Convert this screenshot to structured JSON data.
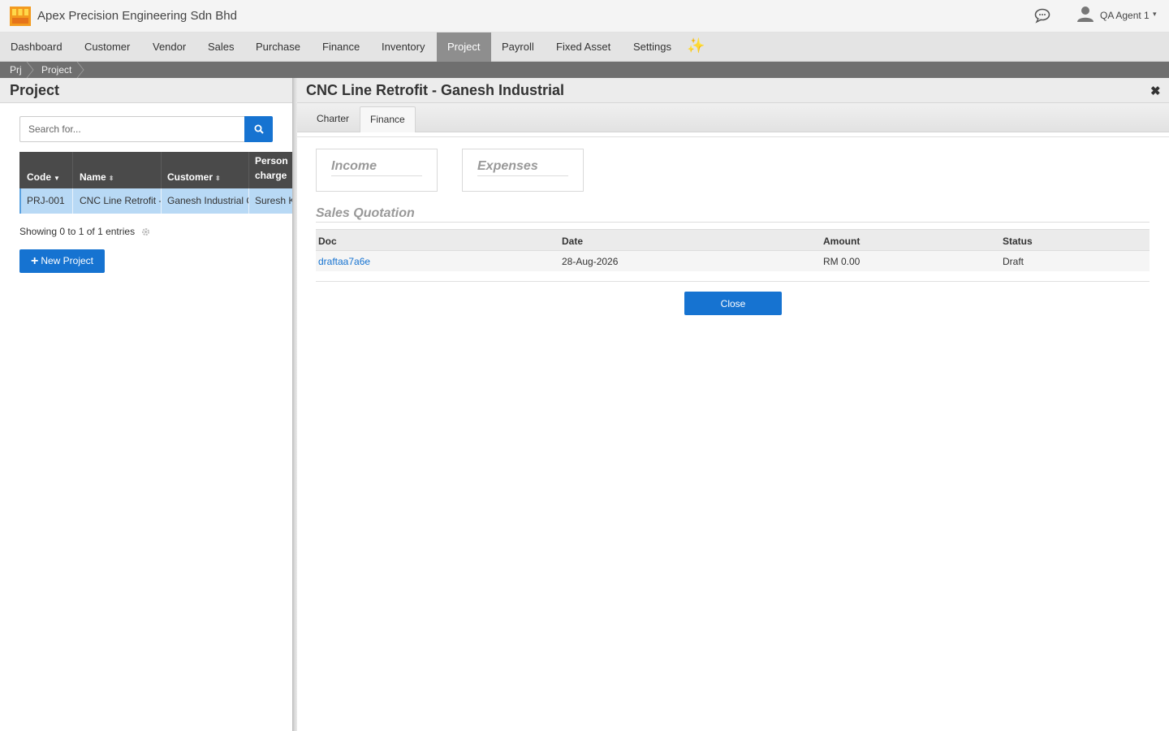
{
  "header": {
    "company_name": "Apex Precision Engineering Sdn Bhd",
    "user_name": "QA Agent 1",
    "caret": "▾"
  },
  "menu": {
    "items": [
      "Dashboard",
      "Customer",
      "Vendor",
      "Sales",
      "Purchase",
      "Finance",
      "Inventory",
      "Project",
      "Payroll",
      "Fixed Asset",
      "Settings"
    ],
    "active": "Project",
    "sparkle": "✨"
  },
  "breadcrumb": [
    "Prj",
    "Project"
  ],
  "left": {
    "title": "Project",
    "search_placeholder": "Search for...",
    "columns": [
      "Code",
      "Name",
      "Customer",
      "Person in charge"
    ],
    "column_lines": [
      "Person",
      "charge"
    ],
    "rows": [
      {
        "code": "PRJ-001",
        "name": "CNC Line Retrofit - Ganesh Industrial",
        "customer": "Ganesh Industrial Co",
        "person": "Suresh Kumar"
      }
    ],
    "showing": "Showing 0 to 1 of 1 entries",
    "new_button": "New Project"
  },
  "right": {
    "title": "CNC Line Retrofit - Ganesh Industrial",
    "close_symbol": "✖",
    "tabs": [
      "Charter",
      "Finance"
    ],
    "active_tab": "Finance",
    "income_label": "Income",
    "expenses_label": "Expenses",
    "section_title": "Sales Quotation",
    "table_headers": [
      "Doc",
      "Date",
      "Amount",
      "Status"
    ],
    "table_rows": [
      {
        "doc": "draftaa7a6e",
        "date": "28-Aug-2026",
        "amount": "RM 0.00",
        "status": "Draft"
      }
    ],
    "close_button": "Close"
  },
  "colors": {
    "primary": "#1673d1",
    "active_menu": "#8e8e8e",
    "grid_header": "#4a4a4a",
    "selected_row": "#b8d9f5"
  }
}
